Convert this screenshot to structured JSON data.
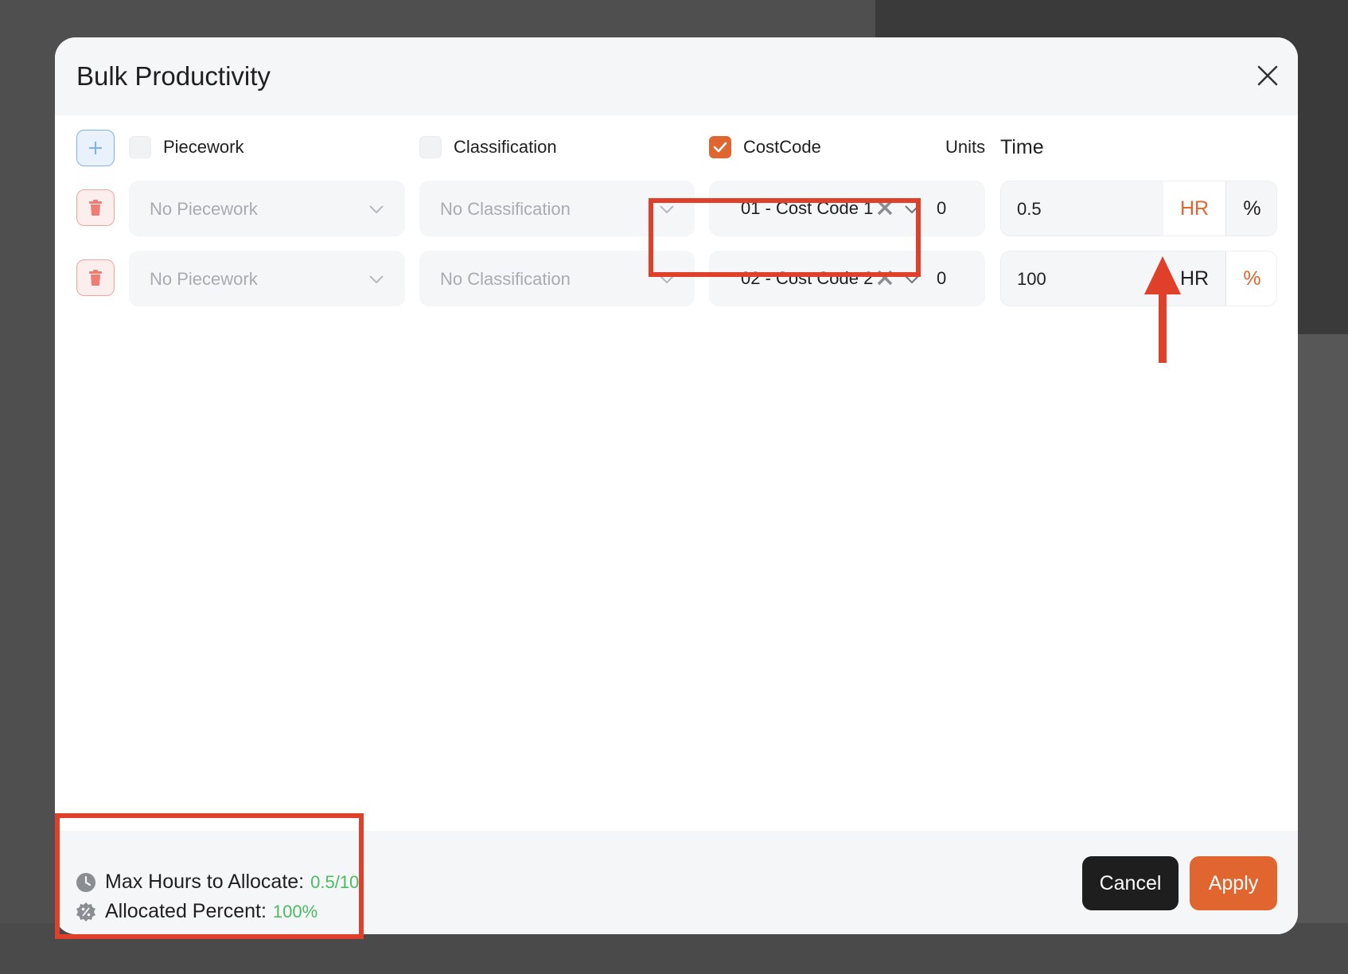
{
  "modal": {
    "title": "Bulk Productivity"
  },
  "columns": {
    "piecework": "Piecework",
    "classification": "Classification",
    "costcode": "CostCode",
    "units": "Units",
    "time": "Time",
    "piecework_checked": false,
    "classification_checked": false,
    "costcode_checked": true
  },
  "rows": [
    {
      "piecework_placeholder": "No Piecework",
      "classification_placeholder": "No Classification",
      "costcode": "01 - Cost Code 1",
      "units": "0",
      "time": "0.5",
      "unit_hr": "HR",
      "unit_pct": "%",
      "active_unit": "HR"
    },
    {
      "piecework_placeholder": "No Piecework",
      "classification_placeholder": "No Classification",
      "costcode": "02 - Cost Code 2",
      "units": "0",
      "time": "100",
      "unit_hr": "HR",
      "unit_pct": "%",
      "active_unit": "%"
    }
  ],
  "footer": {
    "max_hours_label": "Max Hours to Allocate:",
    "max_hours_value": "0.5/10",
    "allocated_label": "Allocated Percent:",
    "allocated_value": "100%",
    "cancel_label": "Cancel",
    "apply_label": "Apply"
  },
  "colors": {
    "accent": "#e0652f",
    "success": "#4cbb63",
    "annotation": "#e0402a"
  },
  "icons": [
    "close-icon",
    "plus-icon",
    "trash-icon",
    "check-icon",
    "chevron-down-icon",
    "clear-icon",
    "clock-icon",
    "percent-badge-icon",
    "arrow-up-icon"
  ]
}
